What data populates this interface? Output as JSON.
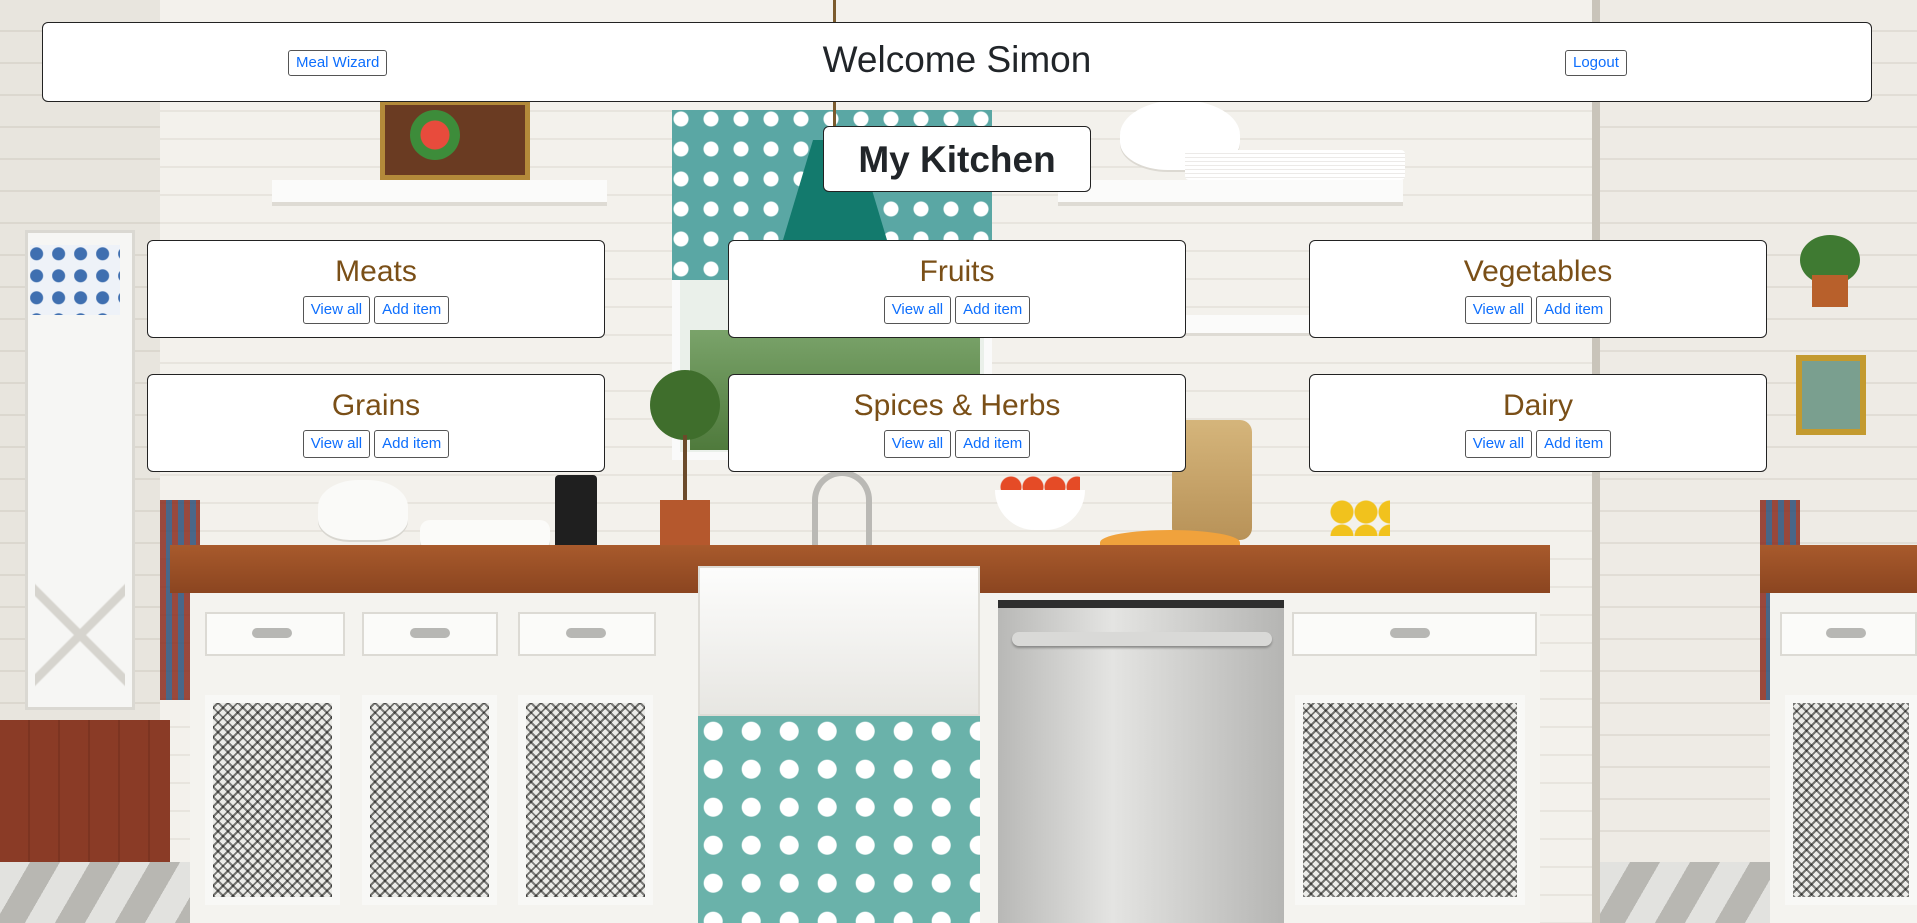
{
  "header": {
    "title": "Welcome Simon",
    "meal_wizard_label": "Meal Wizard",
    "logout_label": "Logout"
  },
  "kitchen": {
    "title": "My Kitchen"
  },
  "categories": [
    {
      "name": "Meats",
      "view_all_label": "View all",
      "add_item_label": "Add item"
    },
    {
      "name": "Fruits",
      "view_all_label": "View all",
      "add_item_label": "Add item"
    },
    {
      "name": "Vegetables",
      "view_all_label": "View all",
      "add_item_label": "Add item"
    },
    {
      "name": "Grains",
      "view_all_label": "View all",
      "add_item_label": "Add item"
    },
    {
      "name": "Spices & Herbs",
      "view_all_label": "View all",
      "add_item_label": "Add item"
    },
    {
      "name": "Dairy",
      "view_all_label": "View all",
      "add_item_label": "Add item"
    }
  ],
  "colors": {
    "category_title": "#7a4f17",
    "link_blue": "#0d6efd",
    "panel_bg": "#ffffff",
    "border": "#222222"
  }
}
